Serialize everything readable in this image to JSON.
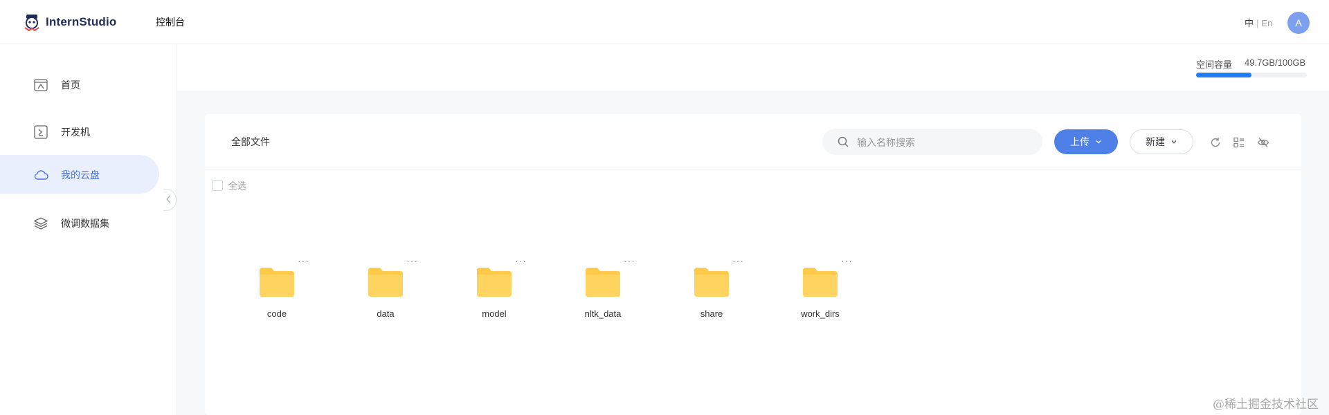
{
  "header": {
    "logo_text": "InternStudio",
    "nav_console": "控制台",
    "lang": {
      "zh": "中",
      "sep": "|",
      "en": "En"
    },
    "avatar_initial": "A"
  },
  "sidebar": {
    "items": [
      {
        "label": "首页",
        "icon": "home-icon",
        "active": false
      },
      {
        "label": "开发机",
        "icon": "terminal-icon",
        "active": false
      },
      {
        "label": "我的云盘",
        "icon": "cloud-icon",
        "active": true
      },
      {
        "label": "微调数据集",
        "icon": "layers-icon",
        "active": false
      }
    ]
  },
  "storage": {
    "label": "空间容量",
    "value": "49.7GB/100GB",
    "used_fraction": 0.497
  },
  "toolbar": {
    "title": "全部文件",
    "search_placeholder": "输入名称搜索",
    "upload_label": "上传",
    "new_label": "新建",
    "icons": [
      "refresh-icon",
      "view-toggle-icon",
      "hide-icon"
    ]
  },
  "select_all_label": "全选",
  "files": [
    {
      "name": "code",
      "more": "···"
    },
    {
      "name": "data",
      "more": "···"
    },
    {
      "name": "model",
      "more": "···"
    },
    {
      "name": "nltk_data",
      "more": "···"
    },
    {
      "name": "share",
      "more": "···"
    },
    {
      "name": "work_dirs",
      "more": "···"
    }
  ],
  "watermark": "@稀土掘金技术社区",
  "colors": {
    "accent": "#4f80e8",
    "storage_fill": "#1f7ef0",
    "folder": "#ffc94a",
    "active_bg": "#e9effc",
    "active_text": "#4d72d8"
  }
}
